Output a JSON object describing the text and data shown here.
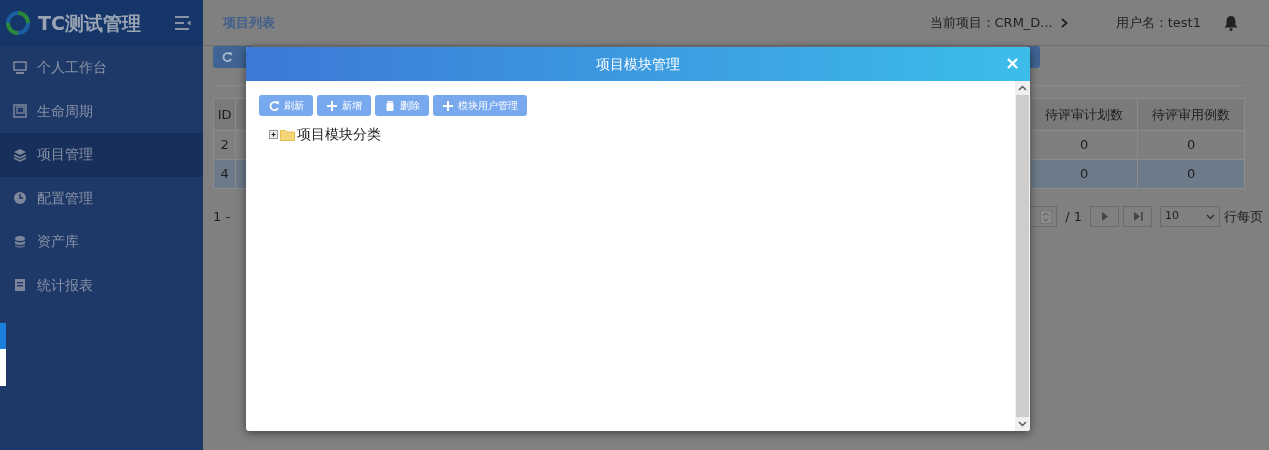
{
  "sidebar": {
    "logo": "TC测试管理",
    "items": [
      {
        "label": "个人工作台",
        "selected": false
      },
      {
        "label": "生命周期",
        "selected": false
      },
      {
        "label": "项目管理",
        "selected": true
      },
      {
        "label": "配置管理",
        "selected": false
      },
      {
        "label": "资产库",
        "selected": false
      },
      {
        "label": "统计报表",
        "selected": false
      }
    ]
  },
  "header": {
    "breadcrumb": "项目列表",
    "project": "当前项目：CRM_D...",
    "user": "用户名：test1"
  },
  "background_table": {
    "columns": [
      "ID",
      "待评审计划数",
      "待评审用例数"
    ],
    "rows": [
      {
        "cells": [
          "2",
          "0",
          "0"
        ],
        "selected": false
      },
      {
        "cells": [
          "4",
          "0",
          "0"
        ],
        "selected": true
      }
    ]
  },
  "pagination": {
    "range": "1 -",
    "total_pages": "/ 1",
    "page_size": "10",
    "per_page_label": "行每页"
  },
  "modal": {
    "title": "项目模块管理",
    "close": "×",
    "buttons": [
      {
        "label": "刷新"
      },
      {
        "label": "新增"
      },
      {
        "label": "删除"
      },
      {
        "label": "模块用户管理"
      }
    ],
    "tree": [
      {
        "label": "项目模块分类",
        "expanded": false
      }
    ]
  }
}
